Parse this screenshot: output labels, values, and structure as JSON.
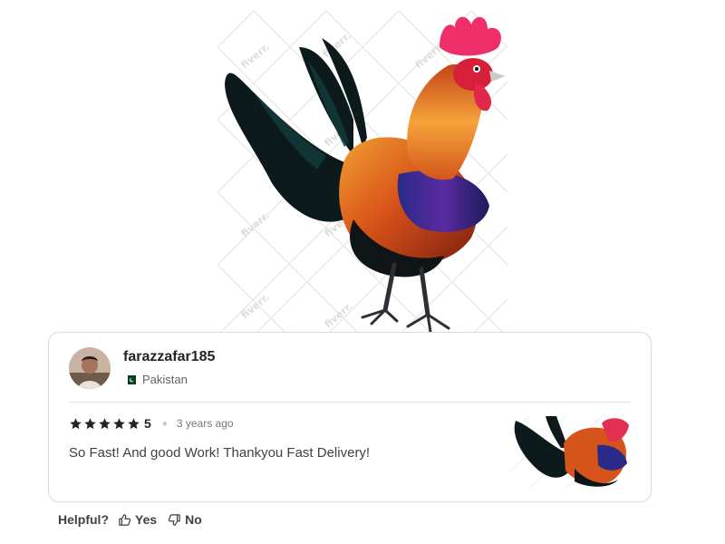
{
  "hero": {
    "image_name": "rooster-illustration",
    "watermark_text": "fiverr."
  },
  "review": {
    "username": "farazzafar185",
    "country": "Pakistan",
    "flag_icon": "pakistan-flag-icon",
    "rating_stars": 5,
    "rating_value": "5",
    "time_ago": "3 years ago",
    "text": "So Fast! And good Work! Thankyou Fast Delivery!",
    "thumbnail_name": "rooster-thumbnail"
  },
  "helpful": {
    "label": "Helpful?",
    "yes_label": "Yes",
    "no_label": "No",
    "yes_icon": "thumbs-up-icon",
    "no_icon": "thumbs-down-icon"
  },
  "colors": {
    "border": "#dadbdd",
    "text_primary": "#222325",
    "text_secondary": "#62646a",
    "star": "#222325"
  }
}
